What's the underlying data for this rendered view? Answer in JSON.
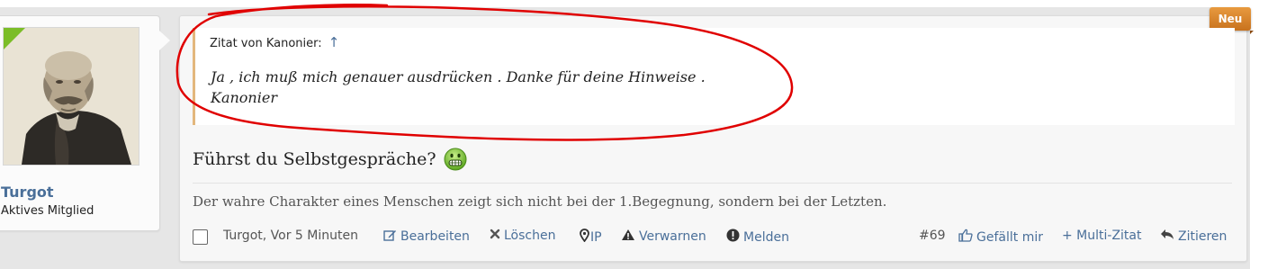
{
  "badge": {
    "label": "Neu"
  },
  "user": {
    "name": "Turgot",
    "title": "Aktives Mitglied"
  },
  "quote": {
    "header": "Zitat von Kanonier:",
    "jump_icon": "↑",
    "lines": [
      "Ja , ich muß mich genauer ausdrücken . Danke für deine Hinweise .",
      "Kanonier"
    ]
  },
  "post": {
    "text": "Führst du Selbstgespräche?",
    "signature": "Der wahre Charakter eines Menschen zeigt sich nicht bei der 1.Begegnung, sondern bei der Letzten."
  },
  "footer": {
    "author_time": "Turgot, Vor 5 Minuten",
    "edit": "Bearbeiten",
    "delete": "Löschen",
    "ip": "IP",
    "warn": "Verwarnen",
    "report": "Melden",
    "post_number": "#69",
    "like": "Gefällt mir",
    "multi_quote": "+ Multi-Zitat",
    "reply_quote": "Zitieren"
  },
  "icons": {
    "edit": "pencil-square-icon",
    "delete": "times-icon",
    "ip": "map-marker-icon",
    "warn": "warning-triangle-icon",
    "report": "exclamation-circle-icon",
    "like": "thumbs-up-icon",
    "quote": "reply-arrow-icon",
    "smiley": "grin-smiley-icon"
  },
  "colors": {
    "link": "#4a6f99",
    "badge": "#d3832a",
    "online": "#7bbd27",
    "quote_border": "#e3b77d",
    "annotation": "#e00000"
  }
}
